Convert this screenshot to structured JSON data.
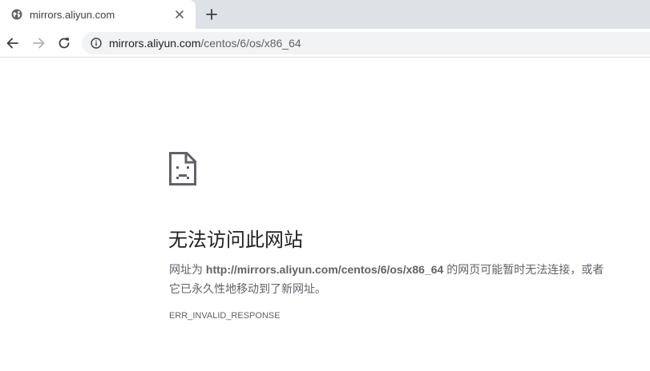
{
  "tab": {
    "title": "mirrors.aliyun.com",
    "favicon": "globe-icon",
    "close_icon": "close-icon"
  },
  "new_tab_icon": "plus-icon",
  "toolbar": {
    "back_icon": "back-arrow-icon",
    "forward_icon": "forward-arrow-icon",
    "reload_icon": "reload-icon",
    "info_icon": "info-icon",
    "url_host": "mirrors.aliyun.com",
    "url_path": "/centos/6/os/x86_64"
  },
  "error": {
    "icon": "sad-page-icon",
    "heading": "无法访问此网站",
    "message_prefix": "网址为 ",
    "message_url": "http://mirrors.aliyun.com/centos/6/os/x86_64",
    "message_suffix_line1": " 的网页可能暂时无法连接，或者",
    "message_line2": "它已永久性地移动到了新网址。",
    "code": "ERR_INVALID_RESPONSE"
  },
  "colors": {
    "tabstrip_bg": "#dee1e6",
    "omnibox_bg": "#f1f3f4",
    "text_primary": "#202124",
    "text_secondary": "#5f6368"
  }
}
